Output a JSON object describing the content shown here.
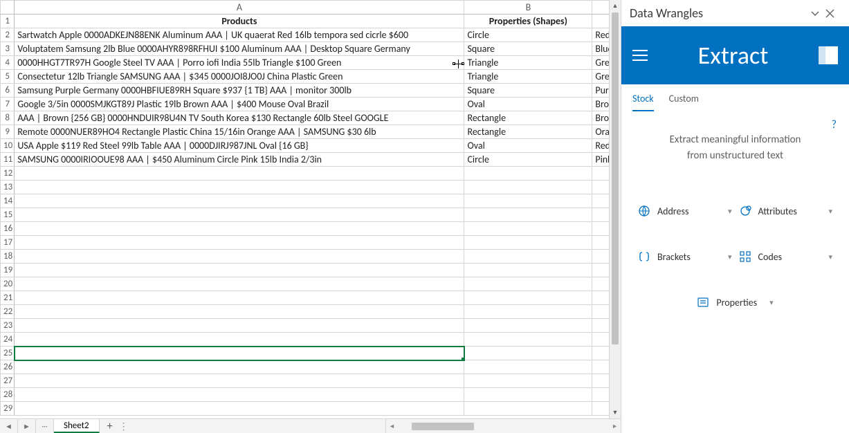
{
  "columns": {
    "a": "A",
    "b": "B"
  },
  "rows": {
    "header": {
      "a": "Products",
      "b": "Properties (Shapes)"
    },
    "data": [
      {
        "n": "2",
        "a": "Sartwatch Apple      0000ADKEJN88ENK Aluminum AAA | UK  quaerat Red 16lb tempora sed cicrle $600",
        "b": "Circle",
        "c": "Red"
      },
      {
        "n": "3",
        "a": "Voluptatem Samsung       2lb Blue 0000AHYR898RFHUI $100 Aluminum AAA | Desktop Square Germany",
        "b": "Square",
        "c": "Blue"
      },
      {
        "n": "4",
        "a": "0000HHGT7TR97H Google      Steel TV AAA | Porro iofi India 55lb Triangle $100 Green",
        "b": "Triangle",
        "c": "Gree"
      },
      {
        "n": "5",
        "a": "Consectetur 12lb Triangle   SAMSUNG      AAA | $345 0000JOI8JO0J China Plastic Green",
        "b": "Triangle",
        "c": "Gree"
      },
      {
        "n": "6",
        "a": "Samsung       Purple Germany 0000HBFIUE89RH Square $937 {1 TB} AAA |  monitor 300lb",
        "b": "Square",
        "c": "Purp"
      },
      {
        "n": "7",
        "a": "Google      3/5in  0000SMJKGT89J  Plastic 19lb Brown AAA | $400 Mouse Oval Brazil",
        "b": "Oval",
        "c": "Brov"
      },
      {
        "n": "8",
        "a": "AAA | Brown {256 GB} 0000HNDUIR98U4N TV South Korea  $130  Rectangle 60lb Steel GOOGLE",
        "b": "Rectangle",
        "c": "Brov"
      },
      {
        "n": "9",
        "a": "Remote 0000NUER89HO4 Rectangle Plastic China 15/16in  Orange AAA | SAMSUNG      $30 6lb",
        "b": "Rectangle",
        "c": "Orar"
      },
      {
        "n": "10",
        "a": "USA Apple       $119 Red Steel 99lb Table AAA | 0000DJIRJ987JNL Oval {16 GB}",
        "b": "Oval",
        "c": "Red"
      },
      {
        "n": "11",
        "a": "SAMSUNG       0000IRIOOUE98   AAA | $450 Aluminum Circle Pink 15lb India 2/3in",
        "b": "Circle",
        "c": "Pink"
      }
    ],
    "empty": [
      "12",
      "13",
      "14",
      "15",
      "16",
      "17",
      "18",
      "19",
      "20",
      "21",
      "22",
      "23",
      "24"
    ],
    "selected": "25",
    "after": [
      "26",
      "27",
      "28",
      "29"
    ]
  },
  "sheet_tab": "Sheet2",
  "panel": {
    "title": "Data Wrangles",
    "band_title": "Extract",
    "tabs": {
      "stock": "Stock",
      "custom": "Custom"
    },
    "subtitle_l1": "Extract meaningful information",
    "subtitle_l2": "from unstructured text",
    "options": {
      "address": "Address",
      "attributes": "Attributes",
      "brackets": "Brackets",
      "codes": "Codes",
      "properties": "Properties"
    }
  }
}
